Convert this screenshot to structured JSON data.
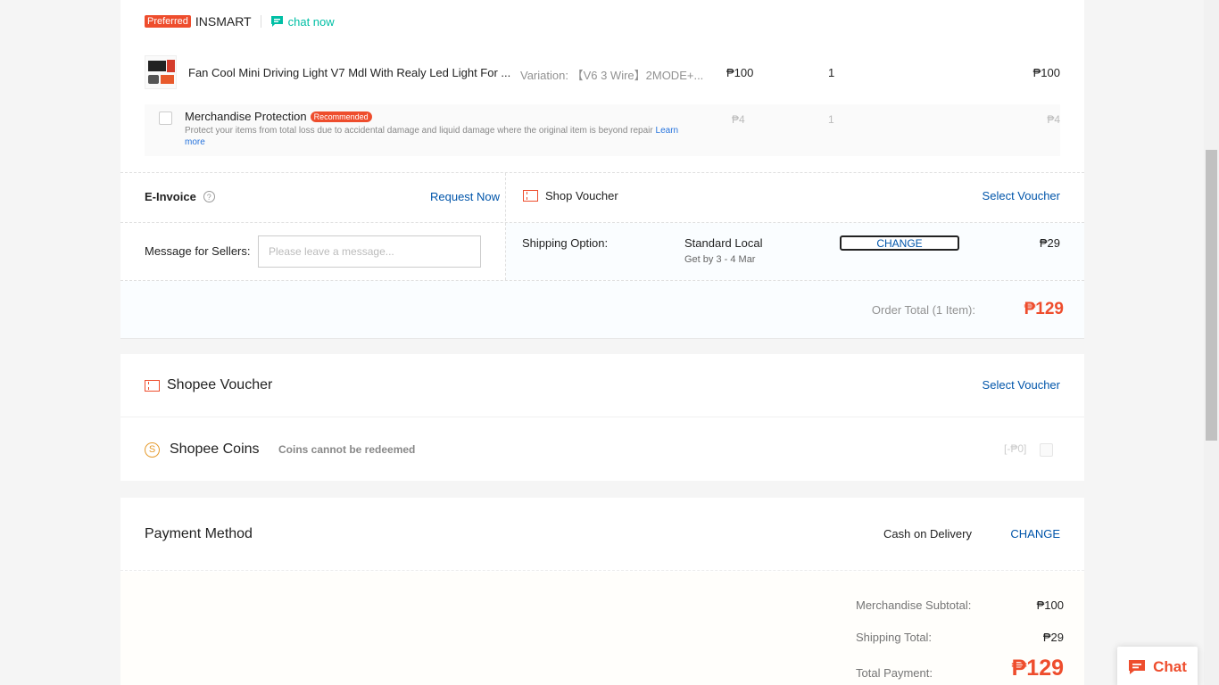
{
  "shop": {
    "badge": "Preferred",
    "name": "INSMART",
    "chat_label": "chat now"
  },
  "item": {
    "name": "Fan Cool Mini Driving Light V7 Mdl With Realy Led Light For ...",
    "variation": "Variation: 【V6 3 Wire】2MODE+...",
    "unit_price": "₱100",
    "quantity": "1",
    "subtotal": "₱100"
  },
  "protection": {
    "title": "Merchandise Protection",
    "badge": "Recommended",
    "description": "Protect your items from total loss due to accidental damage and liquid damage where the original item is beyond repair",
    "learn_more": "Learn more",
    "price": "₱4",
    "quantity": "1",
    "subtotal": "₱4"
  },
  "einvoice": {
    "label": "E-Invoice",
    "help_symbol": "?",
    "action": "Request Now"
  },
  "shop_voucher": {
    "label": "Shop Voucher",
    "action": "Select Voucher"
  },
  "message": {
    "label": "Message for Sellers:",
    "placeholder": "Please leave a message..."
  },
  "shipping": {
    "label": "Shipping Option:",
    "method": "Standard Local",
    "eta": "Get by 3 - 4 Mar",
    "change": "CHANGE",
    "fee": "₱29"
  },
  "order_total": {
    "label": "Order Total (1 Item):",
    "amount": "₱129"
  },
  "shopee_voucher": {
    "label": "Shopee Voucher",
    "action": "Select Voucher"
  },
  "coins": {
    "label": "Shopee Coins",
    "symbol": "S",
    "note": "Coins cannot be redeemed",
    "value": "[-₱0]"
  },
  "payment": {
    "title": "Payment Method",
    "method": "Cash on Delivery",
    "change": "CHANGE"
  },
  "summary": {
    "subtotal_label": "Merchandise Subtotal:",
    "subtotal_value": "₱100",
    "shipping_label": "Shipping Total:",
    "shipping_value": "₱29",
    "total_label": "Total Payment:",
    "total_value": "₱129"
  },
  "chat_widget": {
    "label": "Chat"
  },
  "colors": {
    "brand": "#ee4d2d",
    "link": "#0055aa",
    "chat_teal": "#00bfa5"
  }
}
